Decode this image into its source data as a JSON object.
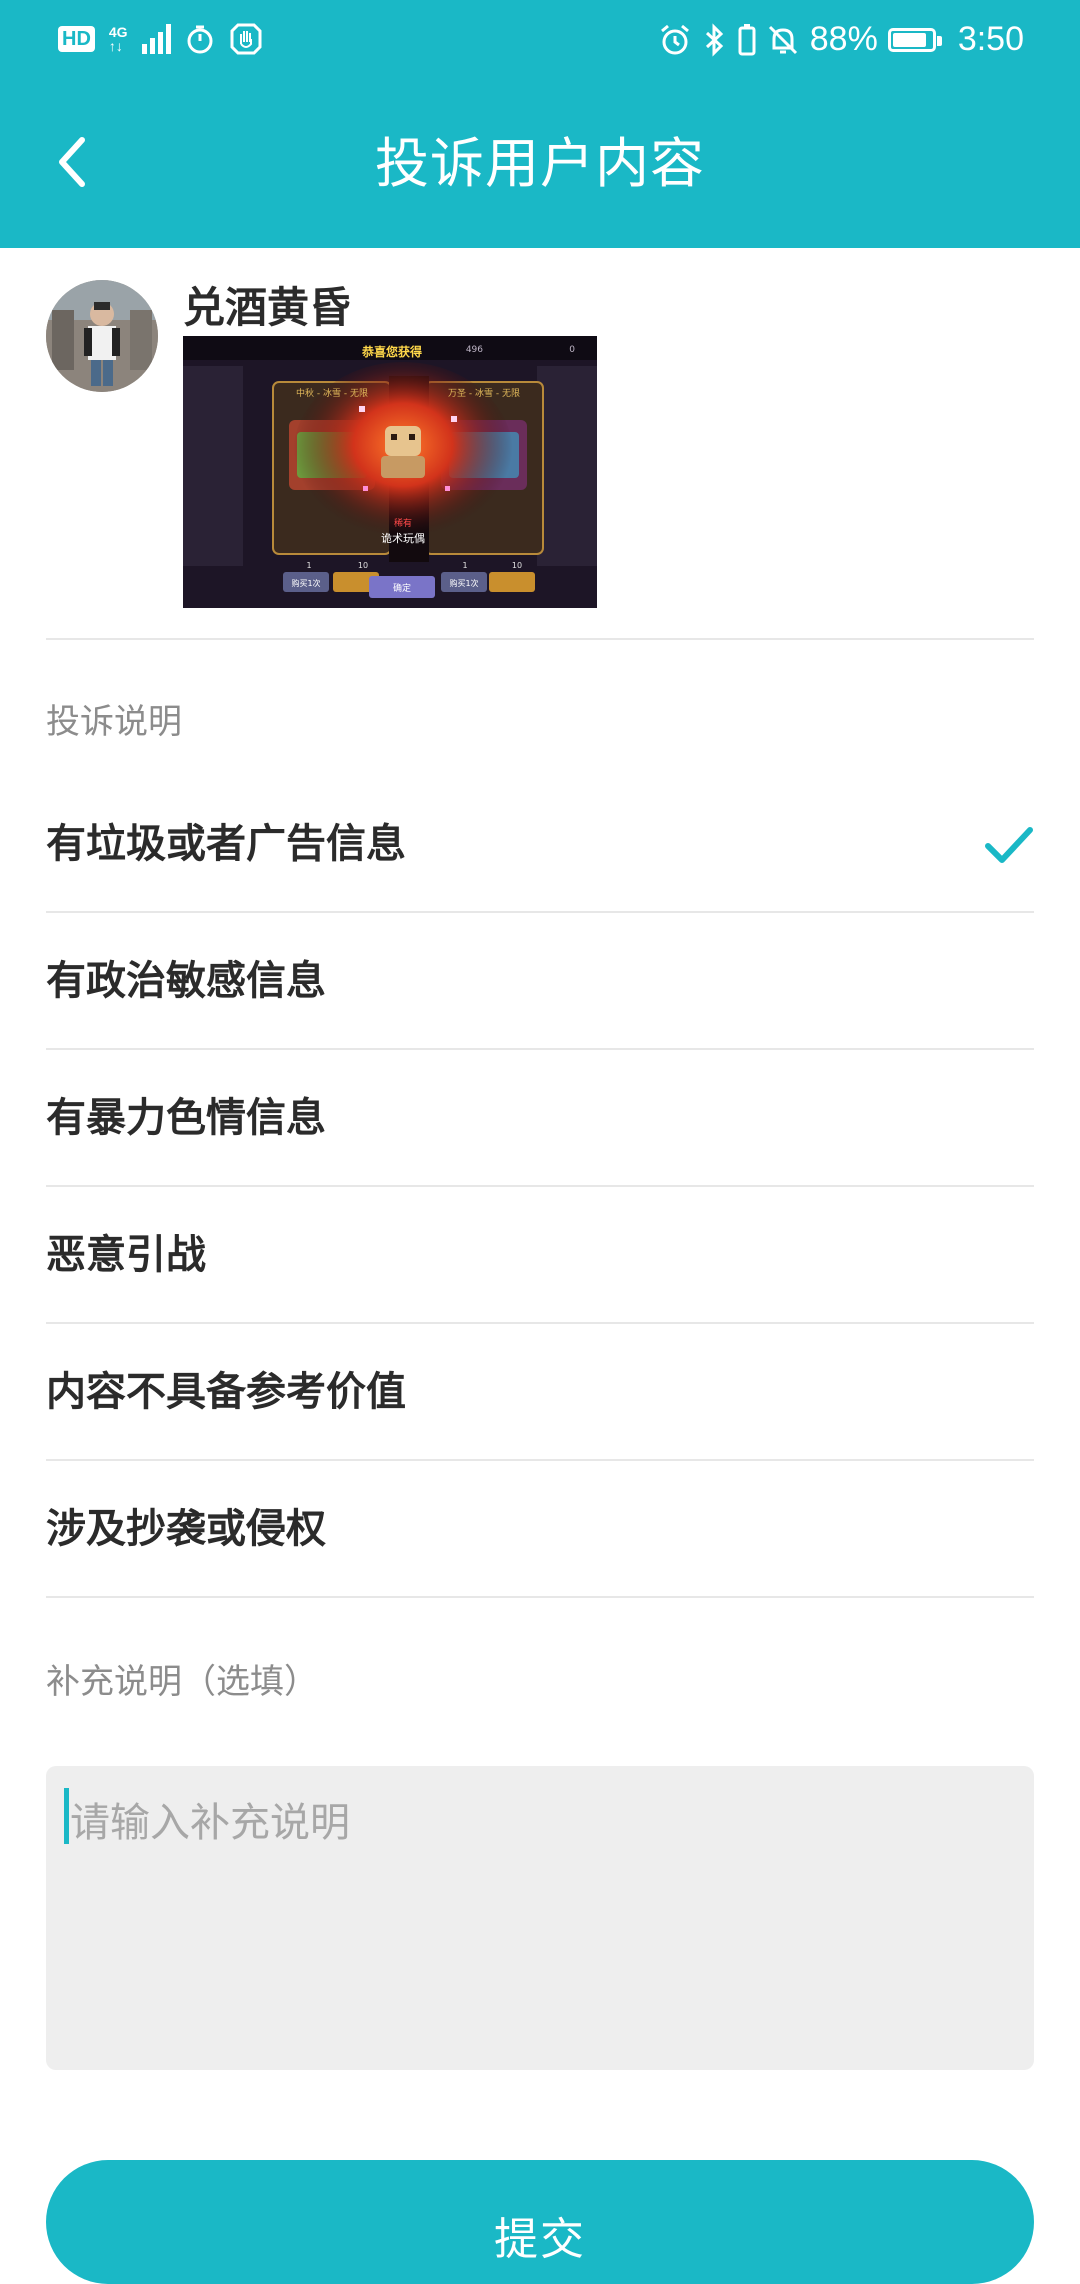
{
  "status_bar": {
    "hd": "HD",
    "network": "4G",
    "network_sub": "↑↓",
    "battery": "88%",
    "battery_level": 0.88,
    "time": "3:50"
  },
  "header": {
    "title": "投诉用户内容",
    "back_icon": "chevron-left-icon"
  },
  "reported": {
    "username": "兑酒黄昏",
    "screenshot": {
      "banner": "恭喜您获得",
      "counter_left": "496",
      "counter_right": "0",
      "card_left_title": "中秋 - 冰雪 - 无限",
      "card_right_title": "万圣 - 冰雪 - 无限",
      "item_tag": "稀有",
      "item_name": "诡术玩偶",
      "cost_left": "1",
      "cost_left_2": "10",
      "cost_right": "1",
      "cost_right_2": "10",
      "buy_once": "购买1次",
      "buy_once_right": "购买1次",
      "confirm": "确定"
    }
  },
  "complaint": {
    "section_label": "投诉说明",
    "reasons": [
      {
        "label": "有垃圾或者广告信息",
        "selected": true
      },
      {
        "label": "有政治敏感信息",
        "selected": false
      },
      {
        "label": "有暴力色情信息",
        "selected": false
      },
      {
        "label": "恶意引战",
        "selected": false
      },
      {
        "label": "内容不具备参考价值",
        "selected": false
      },
      {
        "label": "涉及抄袭或侵权",
        "selected": false
      }
    ]
  },
  "supplement": {
    "section_label": "补充说明（选填）",
    "placeholder": "请输入补充说明",
    "value": ""
  },
  "submit_label": "提交",
  "colors": {
    "accent": "#1ab8c6",
    "divider": "#e7e7e7",
    "input_bg": "#eeeeee",
    "muted_text": "#8c8c8c"
  }
}
